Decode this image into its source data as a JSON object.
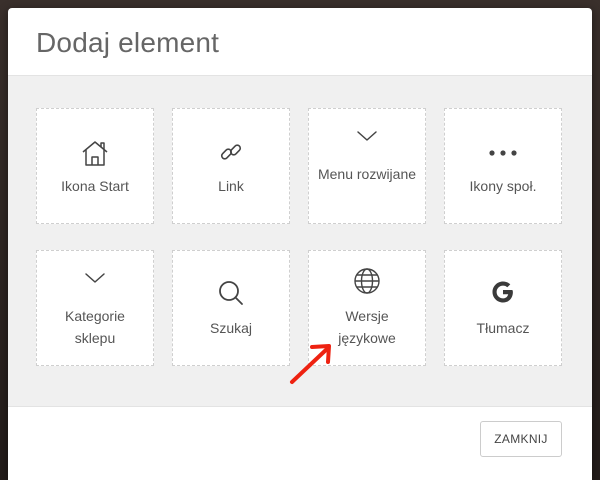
{
  "modal": {
    "title": "Dodaj element",
    "items": [
      {
        "label": "Ikona Start",
        "icon": "home-icon"
      },
      {
        "label": "Link",
        "icon": "link-icon"
      },
      {
        "label": "Menu rozwijane",
        "icon": "chevron-down-icon"
      },
      {
        "label": "Ikony społ.",
        "icon": "more-horizontal-icon"
      },
      {
        "label": "Kategorie sklepu",
        "icon": "chevron-down-icon"
      },
      {
        "label": "Szukaj",
        "icon": "search-icon"
      },
      {
        "label": "Wersje językowe",
        "icon": "globe-icon"
      },
      {
        "label": "Tłumacz",
        "icon": "google-g-icon"
      }
    ],
    "close_label": "ZAMKNIJ"
  },
  "annotation": {
    "icon": "arrow-up-right-icon",
    "color": "#ee2211"
  }
}
